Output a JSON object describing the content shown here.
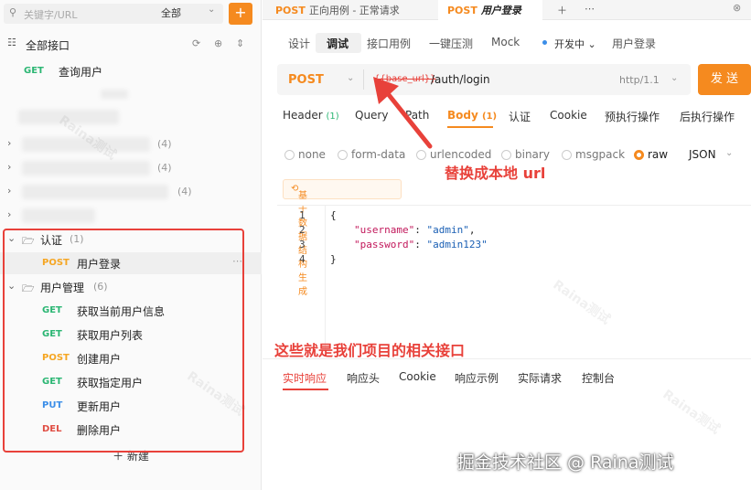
{
  "sidebar": {
    "search_placeholder": "关键字/URL",
    "scope_label": "全部",
    "add_label": "+",
    "all_api_label": "全部接口",
    "root_item": {
      "method": "GET",
      "label": "查询用户"
    },
    "blurred_folder_counts": [
      "(4)",
      "(4)",
      "(4)"
    ],
    "folders": [
      {
        "label": "认证",
        "count": "(1)",
        "items": [
          {
            "method": "POST",
            "label": "用户登录"
          }
        ]
      },
      {
        "label": "用户管理",
        "count": "(6)",
        "items": [
          {
            "method": "GET",
            "label": "获取当前用户信息"
          },
          {
            "method": "GET",
            "label": "获取用户列表"
          },
          {
            "method": "POST",
            "label": "创建用户"
          },
          {
            "method": "GET",
            "label": "获取指定用户"
          },
          {
            "method": "PUT",
            "label": "更新用户"
          },
          {
            "method": "DEL",
            "label": "删除用户"
          }
        ]
      }
    ],
    "new_label": "新建"
  },
  "top_tabs": [
    {
      "method": "POST",
      "label": "正向用例 - 正常请求"
    },
    {
      "method": "POST",
      "label": "用户登录"
    }
  ],
  "sub_tabs": [
    "设计",
    "调试",
    "接口用例",
    "一键压测",
    "Mock"
  ],
  "env_label": "开发中",
  "env_page_title": "用户登录",
  "request": {
    "method": "POST",
    "base_url": "{{base_url}}",
    "path": "/auth/login",
    "http_version": "http/1.1",
    "send_label": "发 送"
  },
  "request_tabs": [
    {
      "label": "Header",
      "count": "(1)"
    },
    {
      "label": "Query",
      "count": ""
    },
    {
      "label": "Path",
      "count": ""
    },
    {
      "label": "Body",
      "count": "(1)"
    },
    {
      "label": "认证",
      "count": ""
    },
    {
      "label": "Cookie",
      "count": ""
    },
    {
      "label": "预执行操作",
      "count": ""
    },
    {
      "label": "后执行操作",
      "count": ""
    }
  ],
  "body_types": [
    "none",
    "form-data",
    "urlencoded",
    "binary",
    "msgpack",
    "raw"
  ],
  "body_format": "JSON",
  "generate_label": "基于数据结构生成",
  "code": {
    "line_numbers": [
      "1",
      "2",
      "3",
      "4"
    ],
    "open": "{",
    "l2_key": "\"username\"",
    "l2_val": "\"admin\"",
    "l3_key": "\"password\"",
    "l3_val": "\"admin123\"",
    "close": "}"
  },
  "response_tabs": [
    "实时响应",
    "响应头",
    "Cookie",
    "响应示例",
    "实际请求",
    "控制台"
  ],
  "annotations": {
    "replace_url": "替换成本地 url",
    "related_apis": "这些就是我们项目的相关接口"
  },
  "footer_watermark": "掘金技术社区 @ Raina测试",
  "colors": {
    "accent": "#f58a1f",
    "annotation_red": "#e8413a",
    "get": "#2bb673",
    "post": "#f5a623",
    "put": "#3b8ee8",
    "del": "#e04e44"
  }
}
